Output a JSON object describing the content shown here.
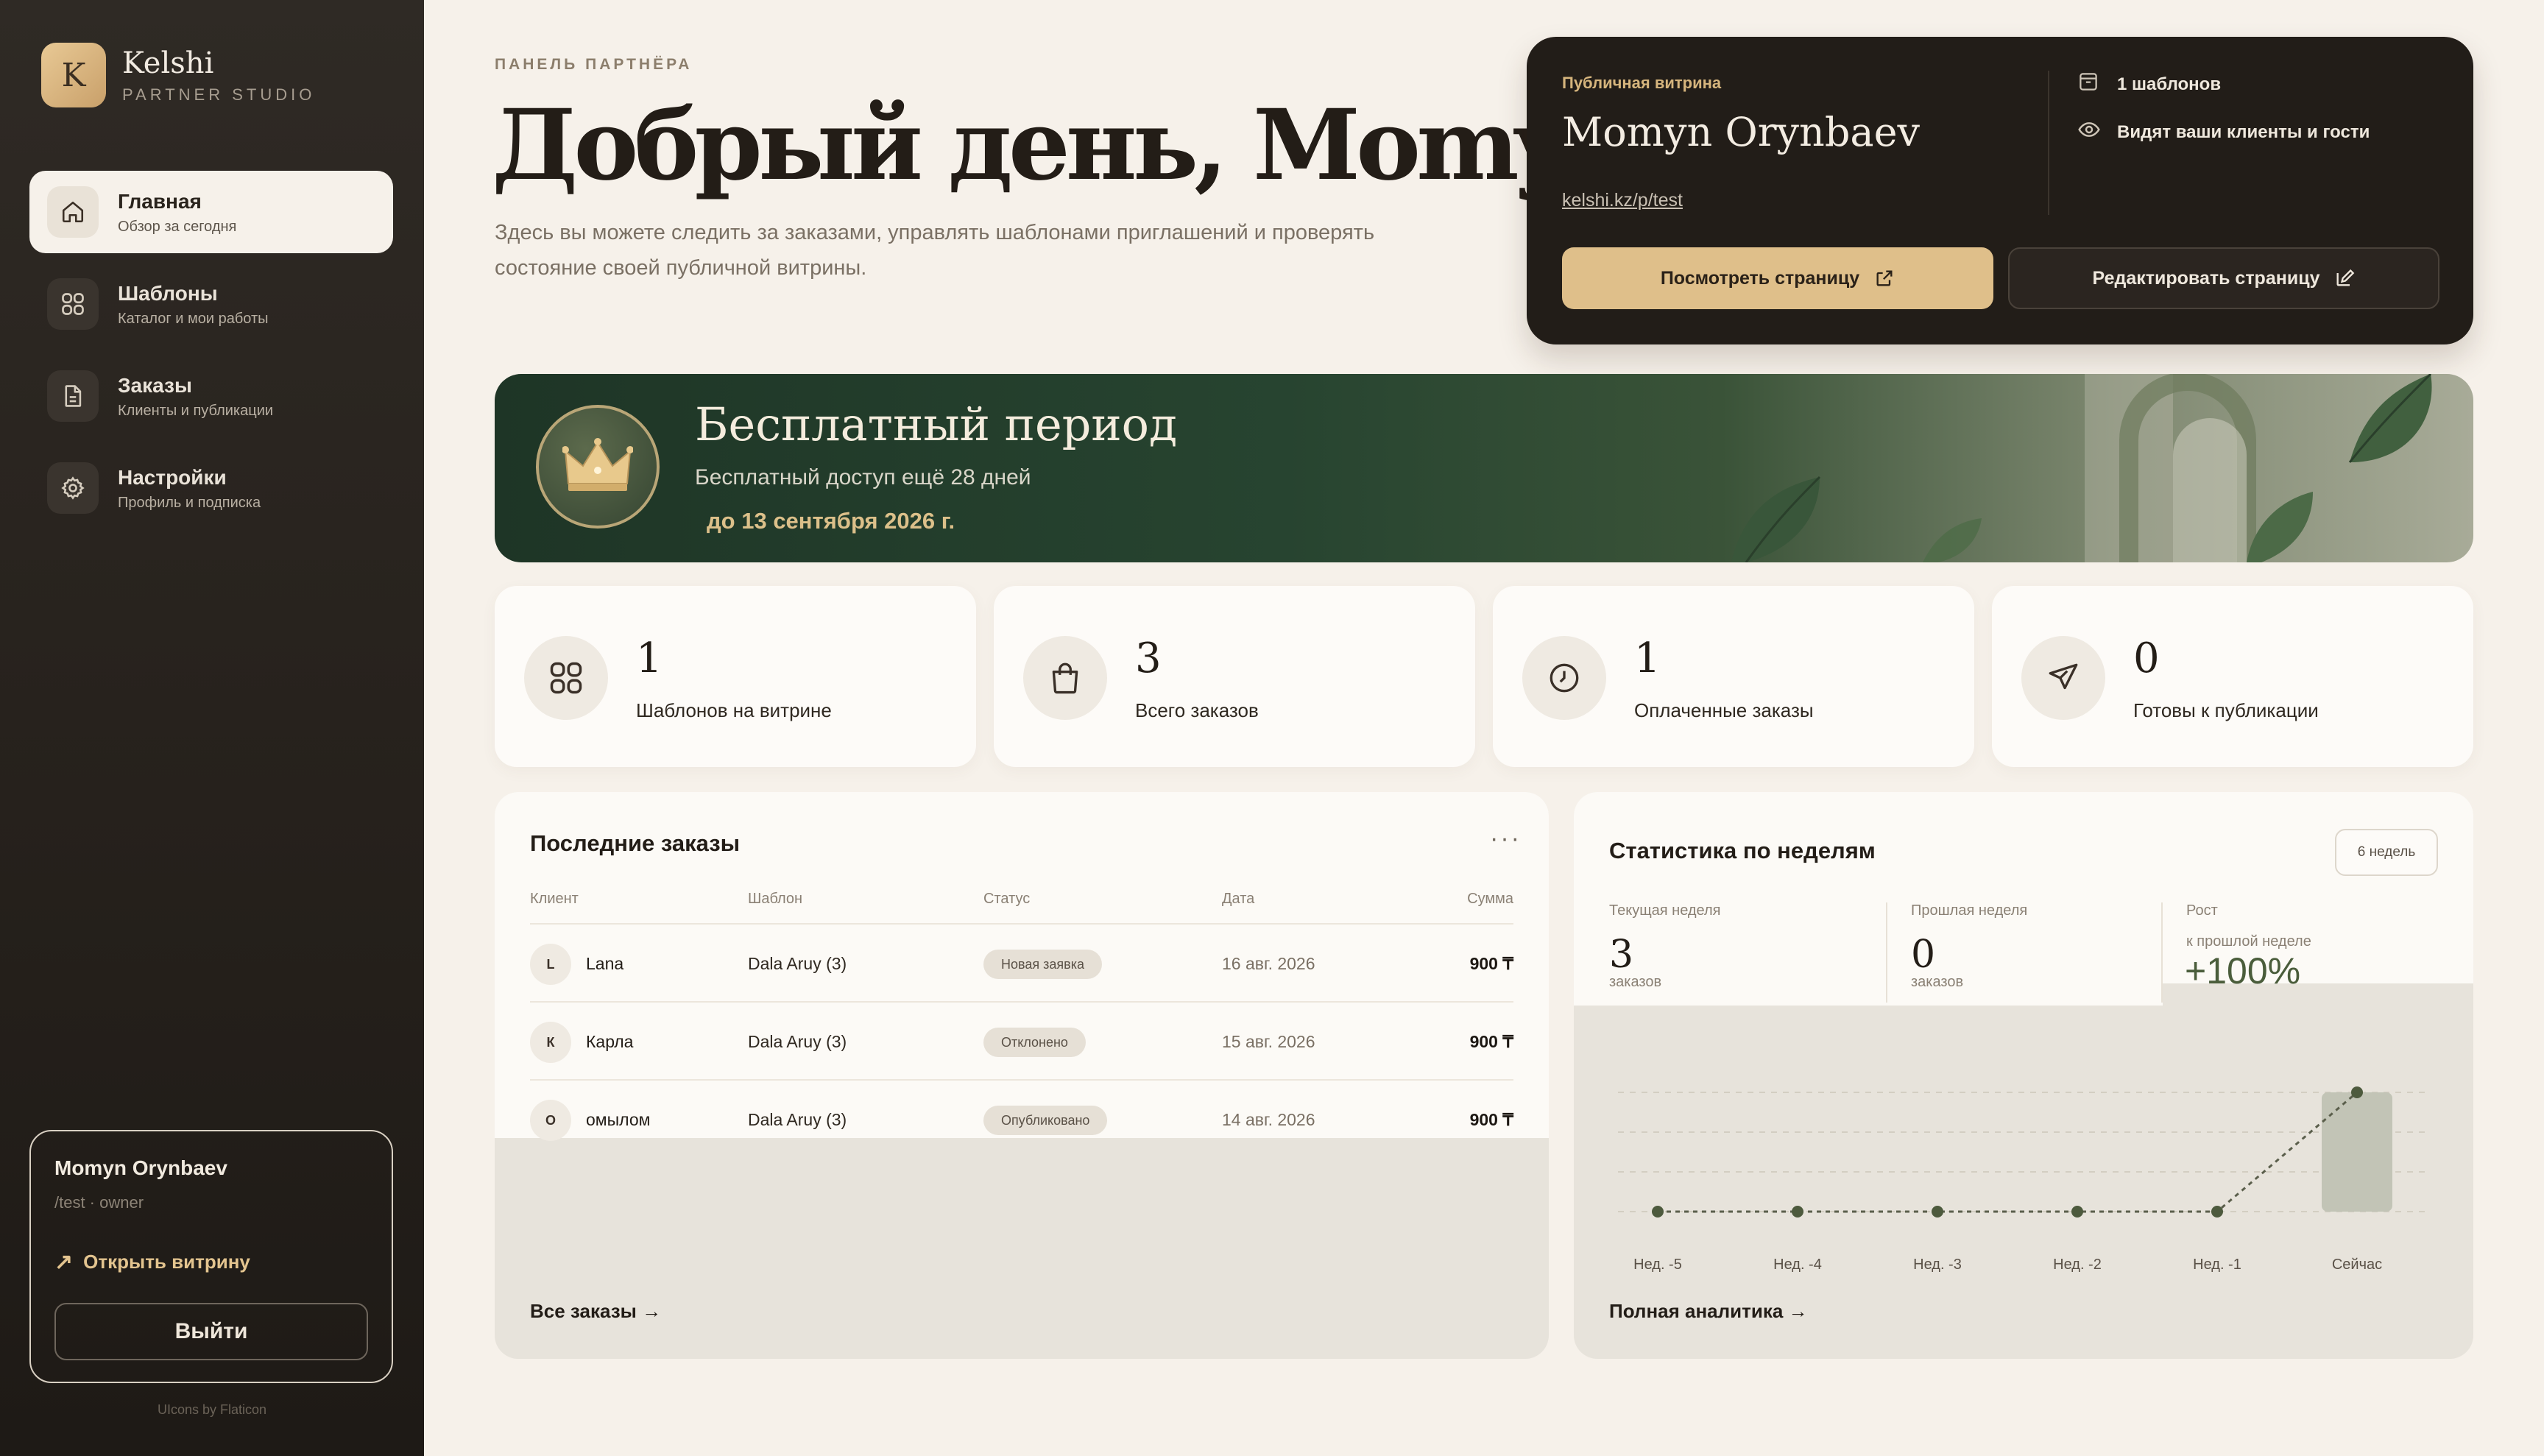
{
  "brand": {
    "initial": "K",
    "name": "Kelshi",
    "subtitle": "PARTNER STUDIO"
  },
  "nav": [
    {
      "title": "Главная",
      "subtitle": "Обзор за сегодня",
      "active": true,
      "icon": "home-icon"
    },
    {
      "title": "Шаблоны",
      "subtitle": "Каталог и мои работы",
      "active": false,
      "icon": "grid-icon"
    },
    {
      "title": "Заказы",
      "subtitle": "Клиенты и публикации",
      "active": false,
      "icon": "document-icon"
    },
    {
      "title": "Настройки",
      "subtitle": "Профиль и подписка",
      "active": false,
      "icon": "gear-icon"
    }
  ],
  "user": {
    "name": "Momyn Orynbaev",
    "meta": "/test · owner",
    "open_link": "Открыть витрину",
    "logout": "Выйти"
  },
  "credit": "UIcons by Flaticon",
  "header": {
    "kicker": "ПАНЕЛЬ ПАРТНЁРА",
    "greeting": "Добрый день, Momyn",
    "intro": "Здесь вы можете следить за заказами, управлять шаблонами приглашений и проверять состояние своей публичной витрины."
  },
  "showcase": {
    "label": "Публичная витрина",
    "name": "Momyn Orynbaev",
    "url": "kelshi.kz/p/test",
    "fact_templates": "1 шаблонов",
    "fact_visibility": "Видят ваши клиенты и гости",
    "view_button": "Посмотреть страницу",
    "edit_button": "Редактировать страницу"
  },
  "banner": {
    "title": "Бесплатный период",
    "subtitle": "Бесплатный доступ ещё 28 дней",
    "until": "до 13 сентября 2026 г."
  },
  "stats": [
    {
      "value": "1",
      "label": "Шаблонов на витрине",
      "icon": "grid-icon"
    },
    {
      "value": "3",
      "label": "Всего заказов",
      "icon": "shopping-bag-icon"
    },
    {
      "value": "1",
      "label": "Оплаченные заказы",
      "icon": "clock-icon"
    },
    {
      "value": "0",
      "label": "Готовы к публикации",
      "icon": "paper-plane-icon"
    }
  ],
  "orders": {
    "title": "Последние заказы",
    "more": "···",
    "columns": [
      "Клиент",
      "Шаблон",
      "Статус",
      "Дата",
      "Сумма"
    ],
    "rows": [
      {
        "initial": "L",
        "client": "Lana",
        "template": "Dala Aruy (3)",
        "status": "Новая заявка",
        "date": "16 авг. 2026",
        "amount": "900 ₸"
      },
      {
        "initial": "К",
        "client": "Карла",
        "template": "Dala Aruy (3)",
        "status": "Отклонено",
        "date": "15 авг. 2026",
        "amount": "900 ₸"
      },
      {
        "initial": "О",
        "client": "омылом",
        "template": "Dala Aruy (3)",
        "status": "Опубликовано",
        "date": "14 авг. 2026",
        "amount": "900 ₸"
      }
    ],
    "all_link": "Все заказы →"
  },
  "weekly": {
    "title": "Статистика по неделям",
    "range_chip": "6 недель",
    "current_label": "Текущая неделя",
    "current_value": "3",
    "current_unit": "заказов",
    "previous_label": "Прошлая неделя",
    "previous_value": "0",
    "previous_unit": "заказов",
    "growth_label": "Рост",
    "growth_sub": "к прошлой неделе",
    "growth_value": "+100%",
    "full_link": "Полная аналитика →"
  },
  "chart_data": {
    "type": "line",
    "categories": [
      "Нед. -5",
      "Нед. -4",
      "Нед. -3",
      "Нед. -2",
      "Нед. -1",
      "Сейчас"
    ],
    "values": [
      0,
      0,
      0,
      0,
      0,
      3
    ],
    "colors": {
      "line": "#5b5f4c",
      "point": "#4d5a3d",
      "highlight_bar": "#c2c4b6"
    }
  },
  "colors": {
    "accent": "#dfbf8a",
    "sidebar": "#2a2520",
    "background": "#f6f1ea",
    "banner": "#274430"
  }
}
